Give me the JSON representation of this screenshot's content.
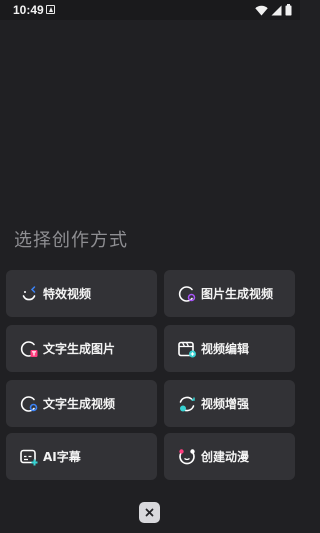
{
  "status_bar": {
    "time": "10:49"
  },
  "title": "选择创作方式",
  "options": [
    {
      "label": "特效视频",
      "icon": "effects-video-icon"
    },
    {
      "label": "图片生成视频",
      "icon": "image-to-video-icon"
    },
    {
      "label": "文字生成图片",
      "icon": "text-to-image-icon"
    },
    {
      "label": "视频编辑",
      "icon": "video-edit-icon"
    },
    {
      "label": "文字生成视频",
      "icon": "text-to-video-icon"
    },
    {
      "label": "视频增强",
      "icon": "video-enhance-icon"
    },
    {
      "label": "AI字幕",
      "icon": "ai-subtitle-icon"
    },
    {
      "label": "创建动漫",
      "icon": "create-anime-icon"
    }
  ],
  "close_label": "×",
  "colors": {
    "background": "#202023",
    "card": "#323236",
    "accent_pink": "#ff3d7f",
    "accent_cyan": "#37d2d2",
    "accent_blue": "#3b82f6",
    "accent_purple": "#a855f7"
  }
}
